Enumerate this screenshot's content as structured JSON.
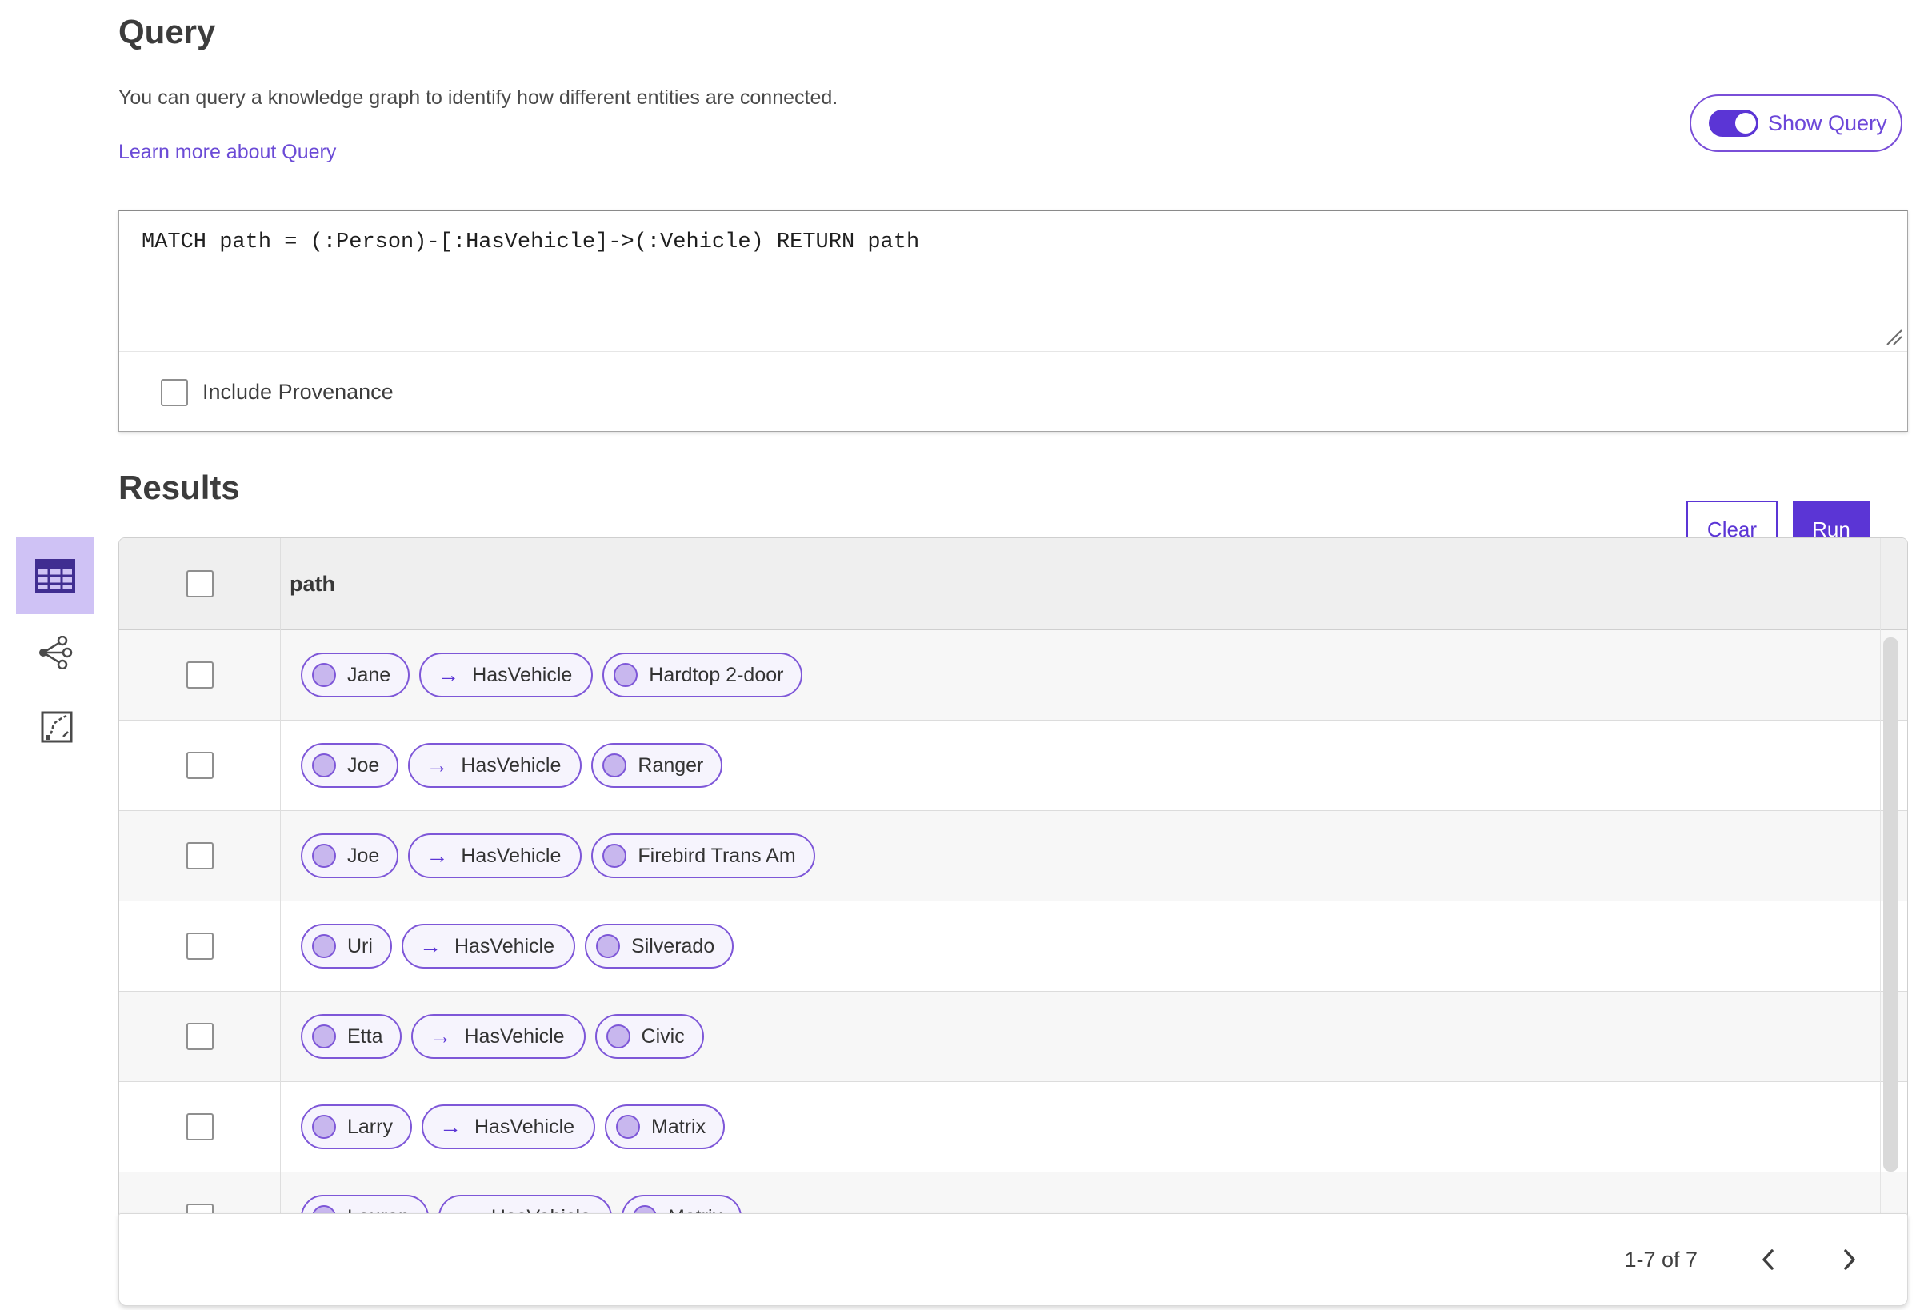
{
  "query_section": {
    "title": "Query",
    "description": "You can query a knowledge graph to identify how different entities are connected.",
    "learn_more_label": "Learn more about Query",
    "show_query_label": "Show Query",
    "show_query_toggle_state": "on",
    "query_text": "MATCH path = (:Person)-[:HasVehicle]->(:Vehicle) RETURN path",
    "include_provenance_label": "Include Provenance",
    "include_provenance_checked": false,
    "clear_label": "Clear",
    "run_label": "Run"
  },
  "results_section": {
    "title": "Results",
    "view_icons": [
      "table-view-icon",
      "graph-view-icon",
      "map-view-icon"
    ],
    "selected_view": "table-view-icon",
    "column_header": "path",
    "select_all_checked": false,
    "rows": [
      {
        "source": "Jane",
        "relation": "HasVehicle",
        "target": "Hardtop 2-door"
      },
      {
        "source": "Joe",
        "relation": "HasVehicle",
        "target": "Ranger"
      },
      {
        "source": "Joe",
        "relation": "HasVehicle",
        "target": "Firebird Trans Am"
      },
      {
        "source": "Uri",
        "relation": "HasVehicle",
        "target": "Silverado"
      },
      {
        "source": "Etta",
        "relation": "HasVehicle",
        "target": "Civic"
      },
      {
        "source": "Larry",
        "relation": "HasVehicle",
        "target": "Matrix"
      },
      {
        "source": "Lauren",
        "relation": "HasVehicle",
        "target": "Matrix"
      }
    ],
    "pagination": {
      "range_label": "1-7 of 7"
    }
  },
  "icons": {
    "arrow_right": "→"
  },
  "colors": {
    "accent_purple": "#5b35d5",
    "chip_border": "#7e57d8",
    "chip_background": "#f6f4fd",
    "chip_circle_fill": "#c8b7ee",
    "link_purple": "#6b4bd6",
    "selected_tab_background": "#cfc2f5",
    "table_header_background": "#efefef",
    "alt_row_background": "#f7f7f7"
  }
}
